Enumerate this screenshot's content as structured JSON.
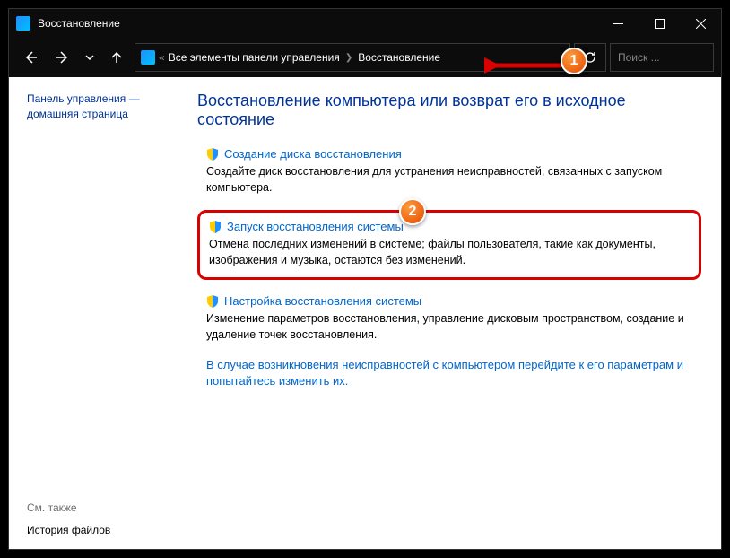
{
  "window": {
    "title": "Восстановление"
  },
  "breadcrumbs": {
    "prefix": "«",
    "item1": "Все элементы панели управления",
    "item2": "Восстановление"
  },
  "search": {
    "placeholder": "Поиск ..."
  },
  "sidebar": {
    "home": "Панель управления — домашняя страница",
    "see_also_label": "См. также",
    "see_also_link": "История файлов"
  },
  "main": {
    "heading": "Восстановление компьютера или возврат его в исходное состояние",
    "items": [
      {
        "title": "Создание диска восстановления",
        "desc": "Создайте диск восстановления для устранения неисправностей, связанных с запуском компьютера."
      },
      {
        "title": "Запуск восстановления системы",
        "desc": "Отмена последних изменений в системе; файлы пользователя, такие как документы, изображения и музыка, остаются без изменений."
      },
      {
        "title": "Настройка восстановления системы",
        "desc": "Изменение параметров восстановления, управление дисковым пространством, создание и удаление точек восстановления."
      }
    ],
    "bottom_link": "В случае возникновения неисправностей с компьютером перейдите к его параметрам и попытайтесь изменить их."
  },
  "callouts": {
    "c1": "1",
    "c2": "2"
  }
}
